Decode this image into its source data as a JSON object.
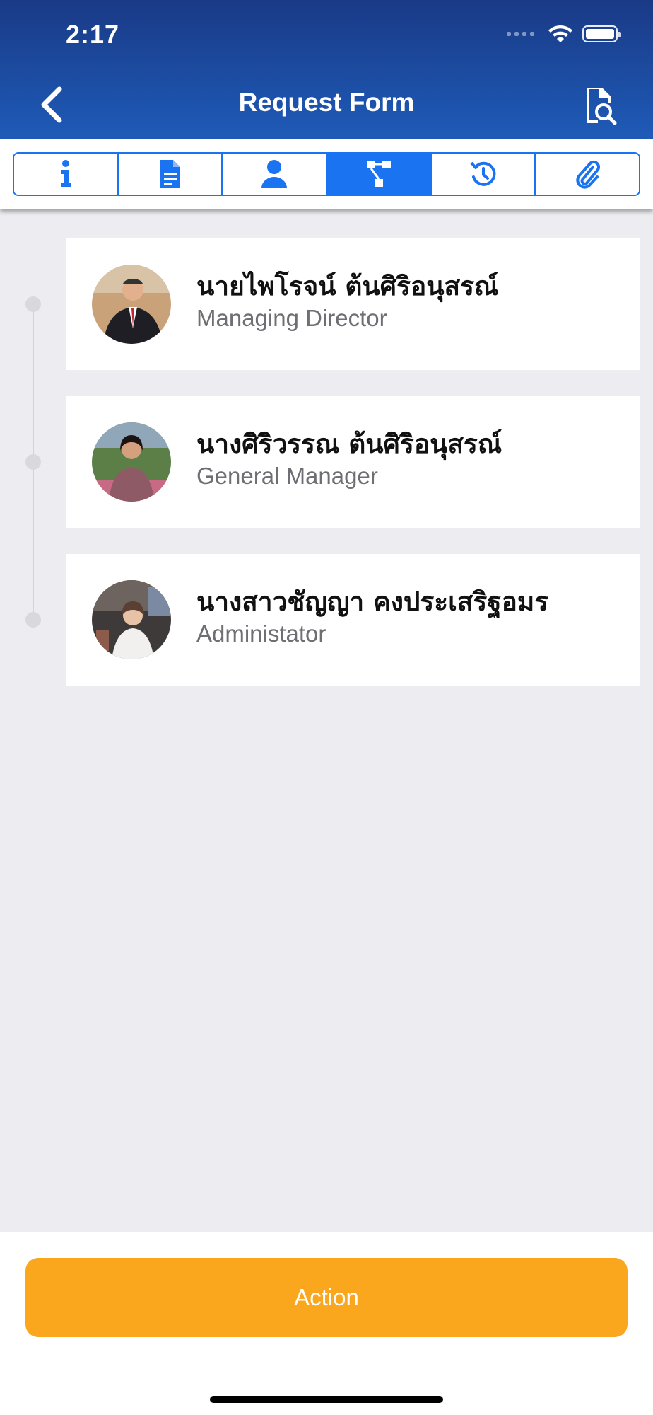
{
  "status_bar": {
    "time": "2:17"
  },
  "nav": {
    "title": "Request Form",
    "back_icon": "chevron-left-icon",
    "right_icon": "document-search-icon"
  },
  "tabs": [
    {
      "name": "info",
      "icon": "info-icon",
      "active": false
    },
    {
      "name": "document",
      "icon": "document-icon",
      "active": false
    },
    {
      "name": "person",
      "icon": "person-icon",
      "active": false
    },
    {
      "name": "workflow",
      "icon": "workflow-icon",
      "active": true
    },
    {
      "name": "history",
      "icon": "history-icon",
      "active": false
    },
    {
      "name": "attachment",
      "icon": "paperclip-icon",
      "active": false
    }
  ],
  "approvers": [
    {
      "name": "นายไพโรจน์ ต้นศิริอนุสรณ์",
      "role": "Managing Director"
    },
    {
      "name": "นางศิริวรรณ  ต้นศิริอนุสรณ์",
      "role": "General Manager"
    },
    {
      "name": "นางสาวชัญญา คงประเสริฐอมร",
      "role": "Administator"
    }
  ],
  "action": {
    "label": "Action"
  },
  "colors": {
    "header_top": "#1a3a86",
    "header_bottom": "#1e5bb8",
    "accent": "#1a73f0",
    "action": "#fba71d",
    "background": "#ececf1"
  }
}
